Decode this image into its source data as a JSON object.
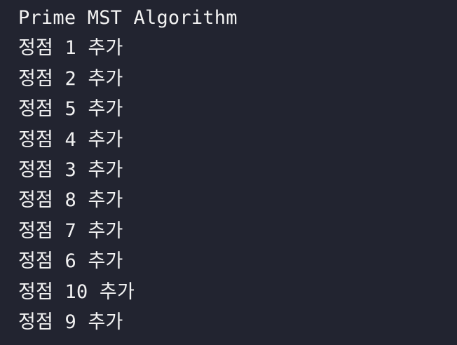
{
  "terminal": {
    "colors": {
      "background": "#222430",
      "text": "#f2f2f2"
    },
    "header": "Prime MST Algorithm",
    "lines": [
      "정점 1 추가",
      "정점 2 추가",
      "정점 5 추가",
      "정점 4 추가",
      "정점 3 추가",
      "정점 8 추가",
      "정점 7 추가",
      "정점 6 추가",
      "정점 10 추가",
      "정점 9 추가"
    ]
  }
}
